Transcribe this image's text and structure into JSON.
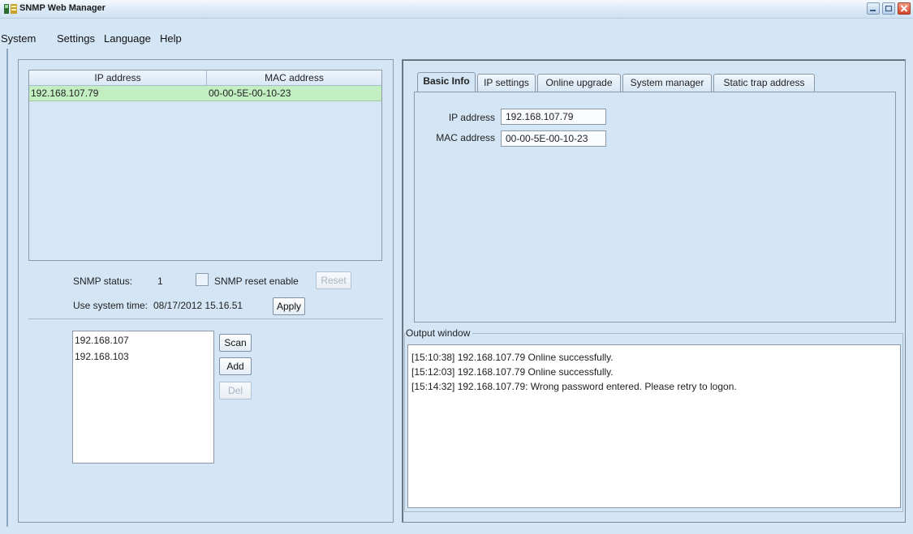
{
  "window": {
    "title": "SNMP Web Manager",
    "app_icon": "snmp-app-icon",
    "controls": [
      "minimize-icon",
      "maximize-icon",
      "close-icon"
    ]
  },
  "menu": [
    {
      "label": "System"
    },
    {
      "label": "Settings"
    },
    {
      "label": "Language"
    },
    {
      "label": "Help"
    }
  ],
  "device_table": {
    "headers": [
      "IP address",
      "MAC address"
    ],
    "rows": [
      {
        "ip": "192.168.107.79",
        "mac": "00-00-5E-00-10-23"
      }
    ],
    "selected_row_color": "#c2eec2"
  },
  "snmp": {
    "status_label": "SNMP status:",
    "status_value": "1",
    "reset_enable_label": "SNMP reset enable",
    "reset_enable_checked": false,
    "reset_button": "Reset",
    "system_time_label": "Use system time:",
    "system_time_value": "08/17/2012 15.16.51",
    "apply_button": "Apply"
  },
  "scan": {
    "ranges": [
      "192.168.107",
      "192.168.103"
    ],
    "scan_button": "Scan",
    "add_button": "Add",
    "del_button": "Del"
  },
  "tabs": [
    {
      "label": "Basic Info",
      "active": true
    },
    {
      "label": "IP settings"
    },
    {
      "label": "Online upgrade"
    },
    {
      "label": "System manager"
    },
    {
      "label": "Static trap address"
    }
  ],
  "basic_info": {
    "ip_label": "IP address",
    "ip_value": "192.168.107.79",
    "mac_label": "MAC address",
    "mac_value": "00-00-5E-00-10-23"
  },
  "output": {
    "title": "Output window",
    "lines": [
      "[15:10:38]  192.168.107.79 Online successfully.",
      "[15:12:03]  192.168.107.79 Online successfully.",
      "[15:14:32]  192.168.107.79: Wrong password entered. Please retry to logon."
    ]
  },
  "colors": {
    "background": "#d4e6f5",
    "close_button": "#d4452a"
  }
}
